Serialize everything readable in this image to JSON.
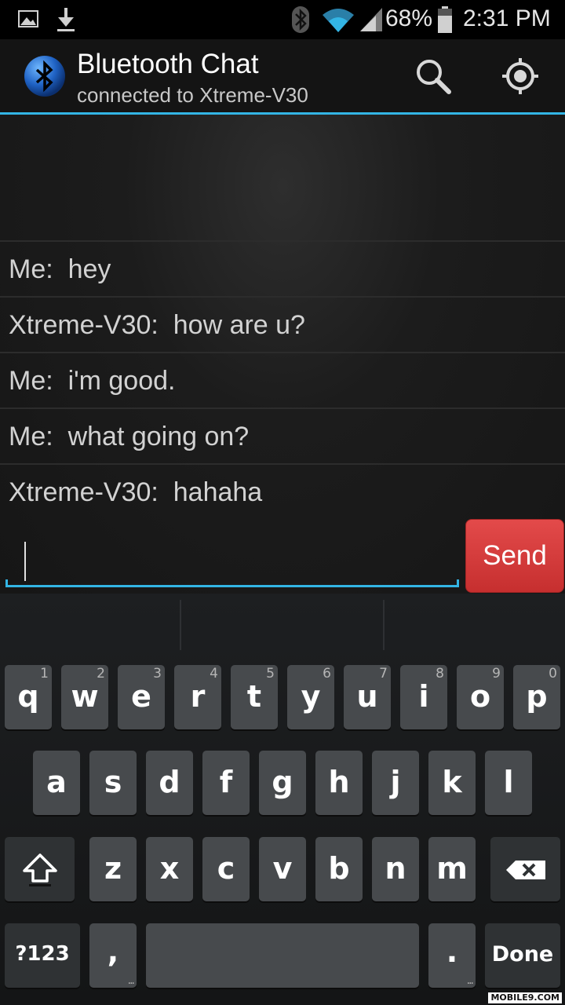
{
  "status_bar": {
    "battery_percent": "68%",
    "time": "2:31 PM",
    "left_icons": [
      "image-icon",
      "download-icon"
    ],
    "right_icons": [
      "bluetooth-icon",
      "wifi-icon",
      "signal-icon",
      "battery-icon"
    ]
  },
  "action_bar": {
    "title": "Bluetooth Chat",
    "subtitle": "connected to Xtreme-V30",
    "actions": [
      "search-icon",
      "discoverable-icon"
    ]
  },
  "messages": [
    {
      "text": "Me:  hey"
    },
    {
      "text": "Xtreme-V30:  how are u?"
    },
    {
      "text": "Me:  i'm good."
    },
    {
      "text": "Me:  what going on?"
    },
    {
      "text": "Xtreme-V30:  hahaha"
    }
  ],
  "compose": {
    "value": "",
    "send_label": "Send"
  },
  "keyboard": {
    "row1": [
      {
        "char": "q",
        "hint": "1"
      },
      {
        "char": "w",
        "hint": "2"
      },
      {
        "char": "e",
        "hint": "3"
      },
      {
        "char": "r",
        "hint": "4"
      },
      {
        "char": "t",
        "hint": "5"
      },
      {
        "char": "y",
        "hint": "6"
      },
      {
        "char": "u",
        "hint": "7"
      },
      {
        "char": "i",
        "hint": "8"
      },
      {
        "char": "o",
        "hint": "9"
      },
      {
        "char": "p",
        "hint": "0"
      }
    ],
    "row2": [
      "a",
      "s",
      "d",
      "f",
      "g",
      "h",
      "j",
      "k",
      "l"
    ],
    "row3": [
      "z",
      "x",
      "c",
      "v",
      "b",
      "n",
      "m"
    ],
    "symbols_label": "?123",
    "comma": ",",
    "period": ".",
    "done_label": "Done"
  },
  "watermark": "MOBILE9.COM",
  "colors": {
    "accent": "#33b5e5",
    "send": "#d63b3b"
  }
}
